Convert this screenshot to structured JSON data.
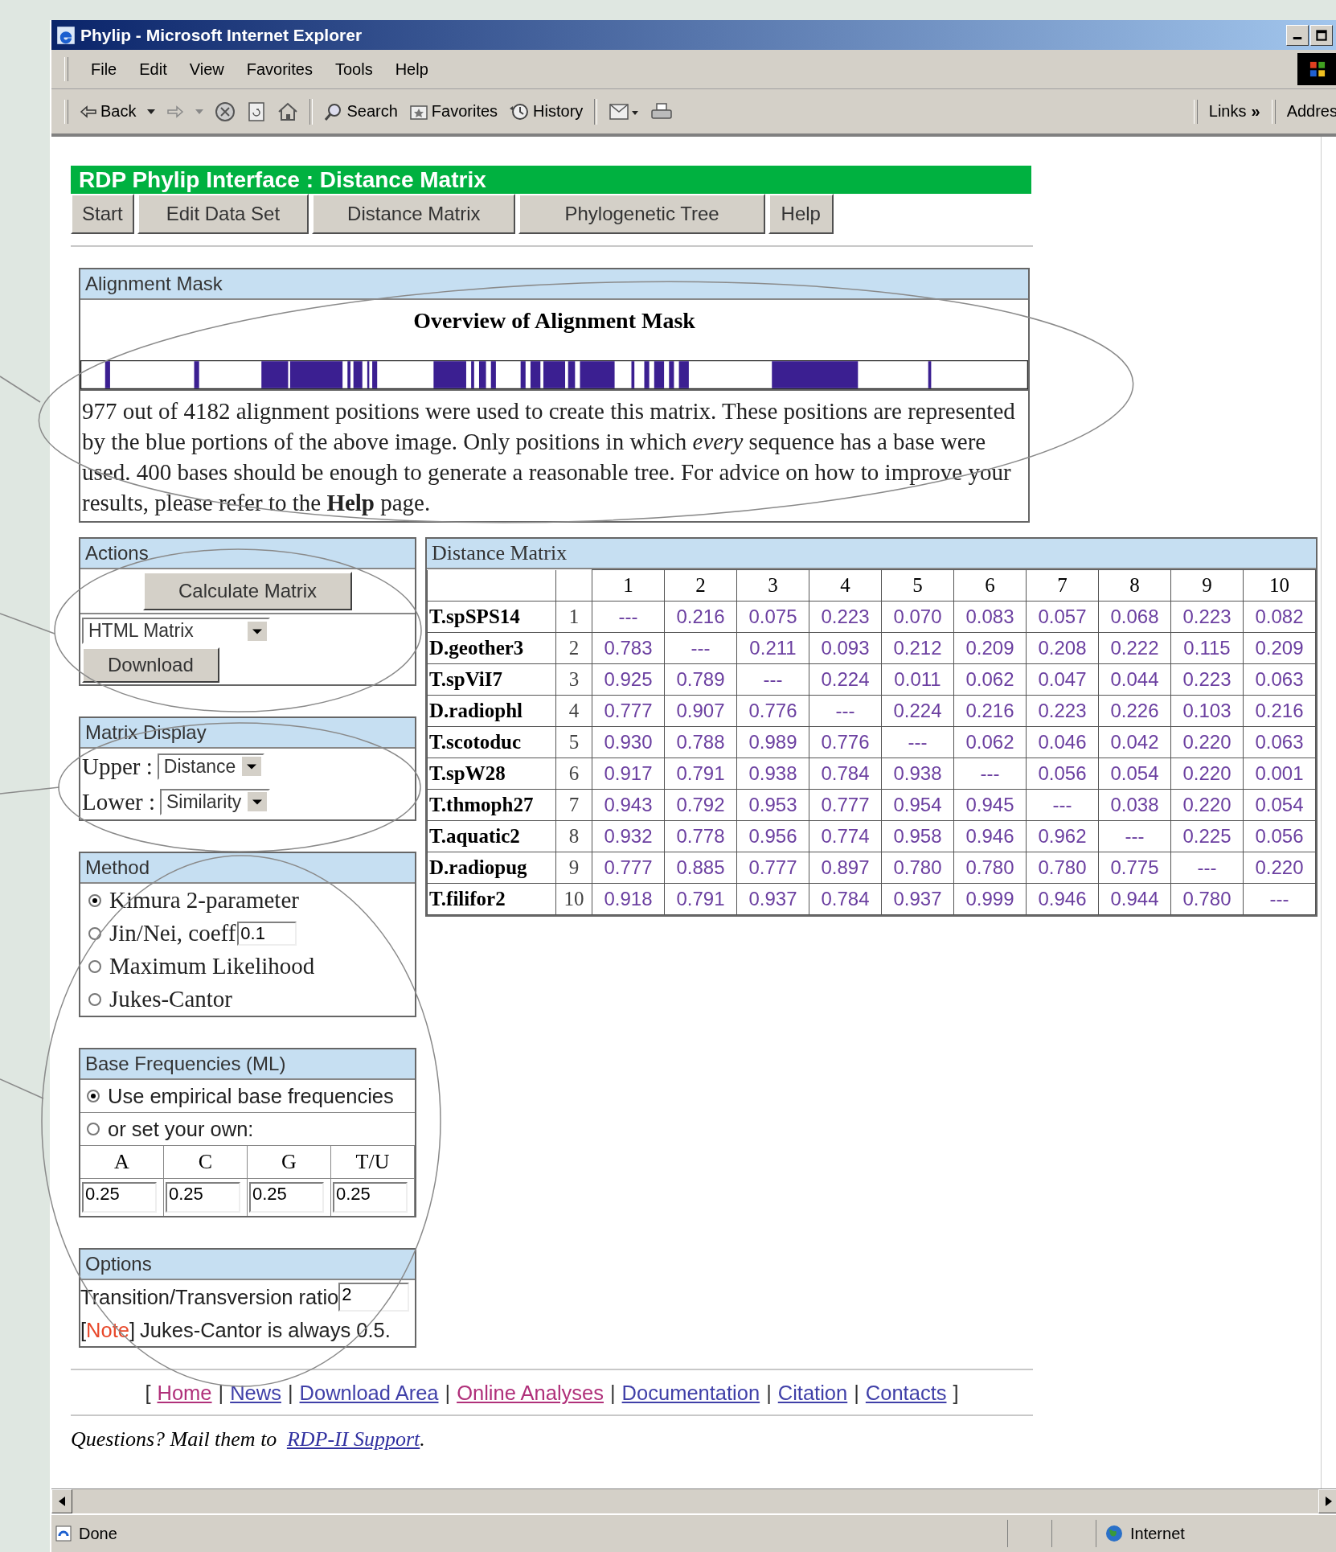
{
  "window": {
    "title": "Phylip - Microsoft Internet Explorer"
  },
  "menu": [
    "File",
    "Edit",
    "View",
    "Favorites",
    "Tools",
    "Help"
  ],
  "toolbar": [
    {
      "kind": "back",
      "label": "Back"
    },
    {
      "kind": "forward"
    },
    {
      "kind": "stop"
    },
    {
      "kind": "refresh"
    },
    {
      "kind": "home"
    },
    {
      "kind": "search",
      "label": "Search"
    },
    {
      "kind": "favorites",
      "label": "Favorites"
    },
    {
      "kind": "history",
      "label": "History"
    },
    {
      "kind": "mail"
    },
    {
      "kind": "print"
    }
  ],
  "links_bar": {
    "label": "Links",
    "chevron": "»",
    "address": "Addres"
  },
  "page": {
    "header": "RDP Phylip Interface : Distance Matrix",
    "nav": [
      "Start",
      "Edit Data Set",
      "Distance Matrix",
      "Phylogenetic Tree",
      "Help"
    ],
    "mask": {
      "title": "Alignment Mask",
      "heading": "Overview of Alignment Mask",
      "text": "977 out of 4182 alignment positions were used to create this matrix. These positions are represented by the blue portions of the above image. Only positions in which *every* sequence has a base were used. 400 bases should be enough to generate a reasonable tree. For advice on how to improve your results, please refer to the **Help** page."
    },
    "actions": {
      "title": "Actions",
      "calculate": "Calculate Matrix",
      "format": "HTML Matrix",
      "download": "Download"
    },
    "display": {
      "title": "Matrix Display",
      "rows": [
        {
          "label": "Upper :",
          "value": "Distance"
        },
        {
          "label": "Lower :",
          "value": "Similarity"
        }
      ]
    },
    "method": {
      "title": "Method",
      "options": [
        {
          "label": "Kimura 2-parameter",
          "selected": true
        },
        {
          "label": "Jin/Nei, coeff",
          "selected": false,
          "input": "0.1"
        },
        {
          "label": "Maximum Likelihood",
          "selected": false
        },
        {
          "label": "Jukes-Cantor",
          "selected": false
        }
      ]
    },
    "base_freq": {
      "title": "Base Frequencies (ML)",
      "options": [
        {
          "label": "Use empirical base frequencies",
          "selected": true
        },
        {
          "label": "or set your own:",
          "selected": false
        }
      ],
      "columns": [
        "A",
        "C",
        "G",
        "T/U"
      ],
      "values": [
        "0.25",
        "0.25",
        "0.25",
        "0.25"
      ]
    },
    "options": {
      "title": "Options",
      "ratio_label": "Transition/Transversion ratio",
      "ratio_value": "2",
      "note_open": "[",
      "note_tag": "Note",
      "note_close": "]",
      "note_text": "Jukes-Cantor is always 0.5."
    },
    "matrix": {
      "title": "Distance Matrix",
      "columns": [
        "1",
        "2",
        "3",
        "4",
        "5",
        "6",
        "7",
        "8",
        "9",
        "10"
      ],
      "rows": [
        {
          "name": "T.spSPS14",
          "index": "1",
          "values": [
            "---",
            "0.216",
            "0.075",
            "0.223",
            "0.070",
            "0.083",
            "0.057",
            "0.068",
            "0.223",
            "0.082"
          ]
        },
        {
          "name": "D.geother3",
          "index": "2",
          "values": [
            "0.783",
            "---",
            "0.211",
            "0.093",
            "0.212",
            "0.209",
            "0.208",
            "0.222",
            "0.115",
            "0.209"
          ]
        },
        {
          "name": "T.spViI7",
          "index": "3",
          "values": [
            "0.925",
            "0.789",
            "---",
            "0.224",
            "0.011",
            "0.062",
            "0.047",
            "0.044",
            "0.223",
            "0.063"
          ]
        },
        {
          "name": "D.radiophl",
          "index": "4",
          "values": [
            "0.777",
            "0.907",
            "0.776",
            "---",
            "0.224",
            "0.216",
            "0.223",
            "0.226",
            "0.103",
            "0.216"
          ]
        },
        {
          "name": "T.scotoduc",
          "index": "5",
          "values": [
            "0.930",
            "0.788",
            "0.989",
            "0.776",
            "---",
            "0.062",
            "0.046",
            "0.042",
            "0.220",
            "0.063"
          ]
        },
        {
          "name": "T.spW28",
          "index": "6",
          "values": [
            "0.917",
            "0.791",
            "0.938",
            "0.784",
            "0.938",
            "---",
            "0.056",
            "0.054",
            "0.220",
            "0.001"
          ]
        },
        {
          "name": "T.thmoph27",
          "index": "7",
          "values": [
            "0.943",
            "0.792",
            "0.953",
            "0.777",
            "0.954",
            "0.945",
            "---",
            "0.038",
            "0.220",
            "0.054"
          ]
        },
        {
          "name": "T.aquatic2",
          "index": "8",
          "values": [
            "0.932",
            "0.778",
            "0.956",
            "0.774",
            "0.958",
            "0.946",
            "0.962",
            "---",
            "0.225",
            "0.056"
          ]
        },
        {
          "name": "D.radiopug",
          "index": "9",
          "values": [
            "0.777",
            "0.885",
            "0.777",
            "0.897",
            "0.780",
            "0.780",
            "0.780",
            "0.775",
            "---",
            "0.220"
          ]
        },
        {
          "name": "T.filifor2",
          "index": "10",
          "values": [
            "0.918",
            "0.791",
            "0.937",
            "0.784",
            "0.937",
            "0.999",
            "0.946",
            "0.944",
            "0.780",
            "---"
          ]
        }
      ]
    },
    "footer": {
      "open": "[",
      "close": "]",
      "links": [
        {
          "label": "Home",
          "visited": true,
          "sep": "|"
        },
        {
          "label": "News",
          "visited": false,
          "sep": "|"
        },
        {
          "label": "Download Area",
          "visited": false,
          "sep": "|"
        },
        {
          "label": "Online Analyses",
          "visited": true,
          "sep": "|"
        },
        {
          "label": "Documentation",
          "visited": false,
          "sep": "|"
        },
        {
          "label": "Citation",
          "visited": false,
          "sep": "|"
        },
        {
          "label": "Contacts",
          "visited": false
        }
      ],
      "question": "Questions? Mail them to",
      "contact": "RDP-II Support",
      "end": "."
    }
  },
  "status_bar": {
    "text": "Done",
    "zone": "Internet"
  }
}
